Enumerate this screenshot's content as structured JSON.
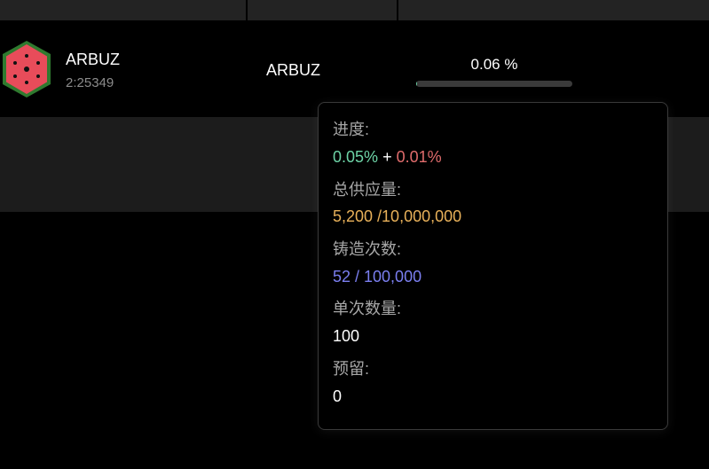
{
  "token": {
    "name": "ARBUZ",
    "id": "2:25349",
    "column_name": "ARBUZ",
    "progress_text": "0.06 %",
    "progress_fraction": 0.0006,
    "icon": "watermelon-icon"
  },
  "tooltip": {
    "progress": {
      "label": "进度:",
      "minted": "0.05%",
      "plus": "+",
      "pending": "0.01%"
    },
    "supply": {
      "label": "总供应量:",
      "value": "5,200 /10,000,000"
    },
    "mints": {
      "label": "铸造次数:",
      "value": "52 / 100,000"
    },
    "per_mint": {
      "label": "单次数量:",
      "value": "100"
    },
    "reserved": {
      "label": "预留:",
      "value": "0"
    }
  },
  "colors": {
    "background": "#000000",
    "header": "#232323",
    "row_alt": "#1c1c1c",
    "green": "#6dd3a6",
    "red": "#e06c6c",
    "orange": "#e8b15a",
    "blue": "#7b7ff0",
    "label_grey": "#a6a6a6"
  }
}
